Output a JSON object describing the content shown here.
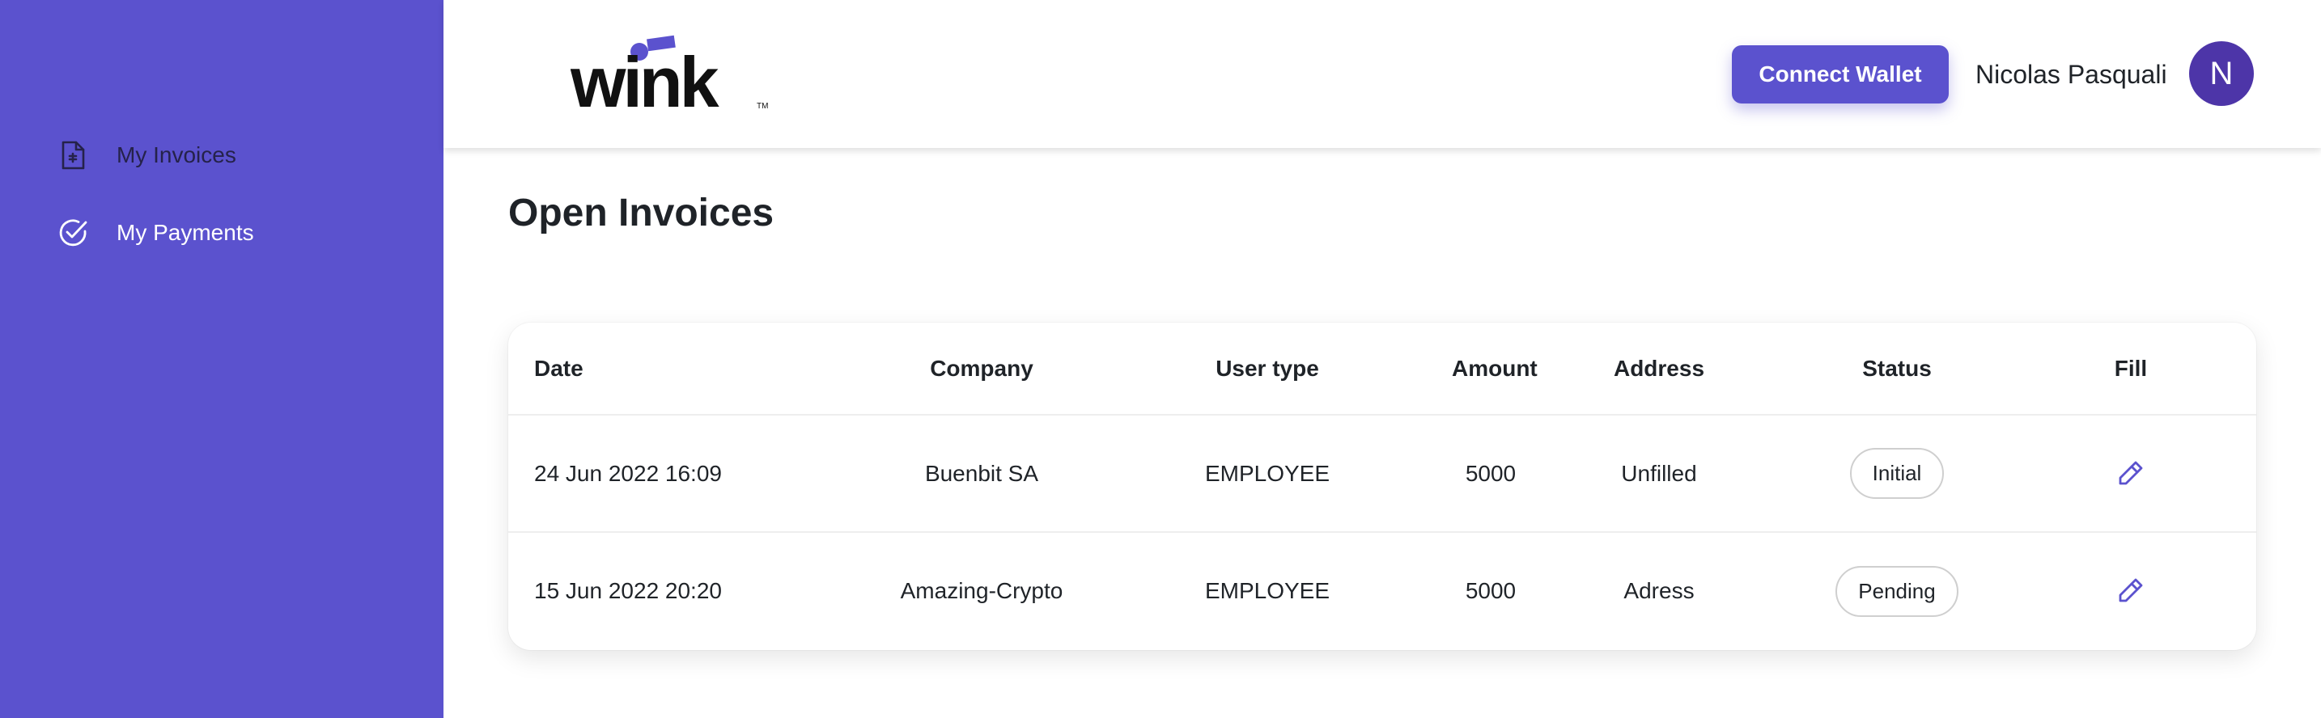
{
  "sidebar": {
    "items": [
      {
        "label": "My Invoices",
        "icon": "file-invoice-icon"
      },
      {
        "label": "My Payments",
        "icon": "check-circle-icon"
      }
    ]
  },
  "header": {
    "logo": "wink",
    "connect_wallet": "Connect Wallet",
    "user_name": "Nicolas Pasquali",
    "avatar_initial": "N"
  },
  "page": {
    "title": "Open Invoices"
  },
  "table": {
    "columns": [
      "Date",
      "Company",
      "User type",
      "Amount",
      "Address",
      "Status",
      "Fill"
    ],
    "rows": [
      {
        "date": "24 Jun 2022 16:09",
        "company": "Buenbit SA",
        "user_type": "EMPLOYEE",
        "amount": "5000",
        "address": "Unfilled",
        "status": "Initial"
      },
      {
        "date": "15 Jun 2022 20:20",
        "company": "Amazing-Crypto",
        "user_type": "EMPLOYEE",
        "amount": "5000",
        "address": "Adress",
        "status": "Pending"
      }
    ]
  },
  "colors": {
    "brand": "#5b52ce",
    "avatar": "#4d35a8",
    "logo_accent": "#5b52ce"
  }
}
